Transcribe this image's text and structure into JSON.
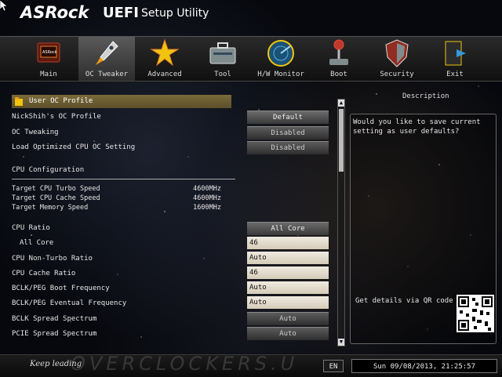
{
  "header": {
    "brand": "ASRock",
    "product": "UEFI",
    "subtitle": "Setup Utility"
  },
  "nav": {
    "active": "oc-tweaker",
    "items": [
      {
        "label": "Main",
        "icon": "main-board-icon"
      },
      {
        "label": "OC Tweaker",
        "icon": "rocket-icon"
      },
      {
        "label": "Advanced",
        "icon": "star-burst-icon"
      },
      {
        "label": "Tool",
        "icon": "toolbox-icon"
      },
      {
        "label": "H/W Monitor",
        "icon": "radar-icon"
      },
      {
        "label": "Boot",
        "icon": "joystick-icon"
      },
      {
        "label": "Security",
        "icon": "shield-icon"
      },
      {
        "label": "Exit",
        "icon": "exit-door-icon"
      }
    ]
  },
  "settings": {
    "user_oc_profile": "User OC Profile",
    "nickshih_profile": {
      "label": "NickShih's OC Profile",
      "value": "Default"
    },
    "oc_tweaking": {
      "label": "OC Tweaking",
      "value": "Disabled"
    },
    "load_optimized": {
      "label": "Load Optimized CPU OC Setting",
      "value": "Disabled"
    },
    "cpu_config_heading": "CPU Configuration",
    "target_turbo": {
      "label": "Target CPU Turbo Speed",
      "value": "4600MHz"
    },
    "target_cache": {
      "label": "Target CPU Cache Speed",
      "value": "4600MHz"
    },
    "target_memory": {
      "label": "Target Memory Speed",
      "value": "1600MHz"
    },
    "cpu_ratio": {
      "label": "CPU Ratio",
      "value": "All Core"
    },
    "all_core": {
      "label": "All Core",
      "value": "46"
    },
    "non_turbo": {
      "label": "CPU Non-Turbo Ratio",
      "value": "Auto"
    },
    "cache_ratio": {
      "label": "CPU Cache Ratio",
      "value": "46"
    },
    "bclk_boot": {
      "label": "BCLK/PEG Boot Frequency",
      "value": "Auto"
    },
    "bclk_eventual": {
      "label": "BCLK/PEG Eventual Frequency",
      "value": "Auto"
    },
    "bclk_spread": {
      "label": "BCLK Spread Spectrum",
      "value": "Auto"
    },
    "pcie_spread": {
      "label": "PCIE Spread Spectrum",
      "value": "Auto"
    }
  },
  "description": {
    "title": "Description",
    "text": "Would you like to save current setting as user defaults?",
    "qr_label": "Get details via QR code"
  },
  "footer": {
    "slogan": "Keep leading",
    "watermark": "OVERCLOCKERS.U",
    "language": "EN",
    "datetime": "Sun 09/08/2013, 21:25:57"
  }
}
